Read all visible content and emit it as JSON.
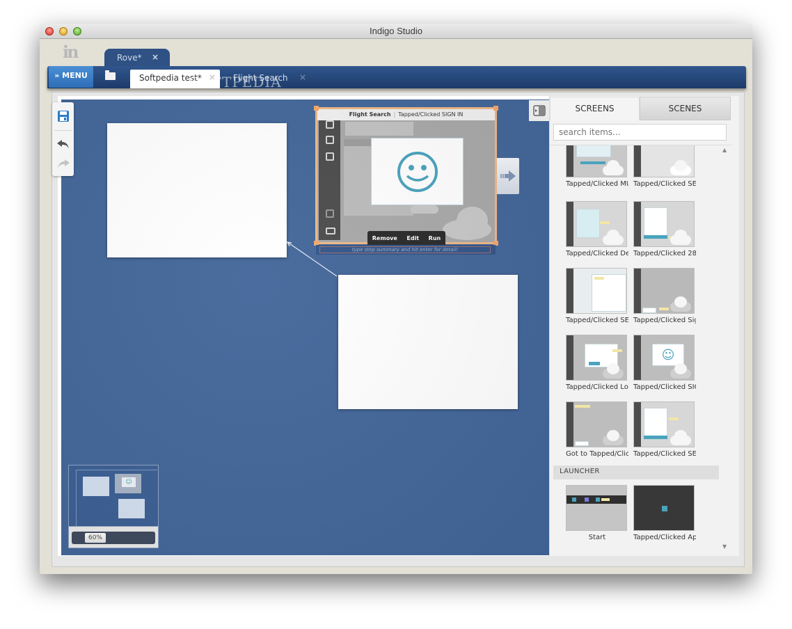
{
  "window": {
    "title": "Indigo Studio"
  },
  "logo": {
    "text": "in",
    "icon": "indigo-logo-icon"
  },
  "project_tab": {
    "label": "Rove*",
    "close": "×"
  },
  "navbar": {
    "menu_label": "» MENU",
    "folder_icon": "folder-icon",
    "tabs": [
      {
        "label": "Softpedia test*",
        "close": "×",
        "active": true
      },
      {
        "label": "Flight Search",
        "close": "×",
        "active": false
      }
    ]
  },
  "watermark": {
    "text": "SOFTPEDIA",
    "url": "www.softpedia.com"
  },
  "toolbar": {
    "save_icon": "save-icon",
    "undo_icon": "undo-icon",
    "redo_icon": "redo-icon"
  },
  "selected_screen": {
    "screen_name": "Flight Search",
    "separator": "|",
    "interaction": "Tapped/Clicked SIGN IN",
    "actions": [
      "Remove",
      "Edit",
      "Run"
    ],
    "summary_placeholder": "type step summary and hit enter for detail!",
    "sidebar_icons": [
      "flights-icon",
      "car-icon",
      "hotel-icon",
      "login-icon",
      "sign-in-icon"
    ]
  },
  "minimap": {
    "zoom_label": "60%",
    "zoom_percent": 60
  },
  "right_panel": {
    "tabs": [
      {
        "label": "SCREENS",
        "active": true
      },
      {
        "label": "SCENES",
        "active": false
      }
    ],
    "search_placeholder": "search items...",
    "items": [
      {
        "label": "Tapped/Clicked MU"
      },
      {
        "label": "Tapped/Clicked SEA"
      },
      {
        "label": "Tapped/Clicked De"
      },
      {
        "label": "Tapped/Clicked 28"
      },
      {
        "label": "Tapped/Clicked SEA"
      },
      {
        "label": "Tapped/Clicked Sig"
      },
      {
        "label": "Tapped/Clicked Log"
      },
      {
        "label": "Tapped/Clicked SIG"
      },
      {
        "label": "Got to Tapped/Clic"
      },
      {
        "label": "Tapped/Clicked SEA"
      }
    ],
    "launcher": {
      "heading": "LAUNCHER",
      "items": [
        {
          "label": "Start"
        },
        {
          "label": "Tapped/Clicked Ap"
        }
      ]
    }
  },
  "colors": {
    "canvas": "#43679a",
    "navbar": "#2a4a7d",
    "menu_button": "#3a7fc9",
    "selection": "#f4a76c",
    "smiley": "#4aa3bd"
  }
}
